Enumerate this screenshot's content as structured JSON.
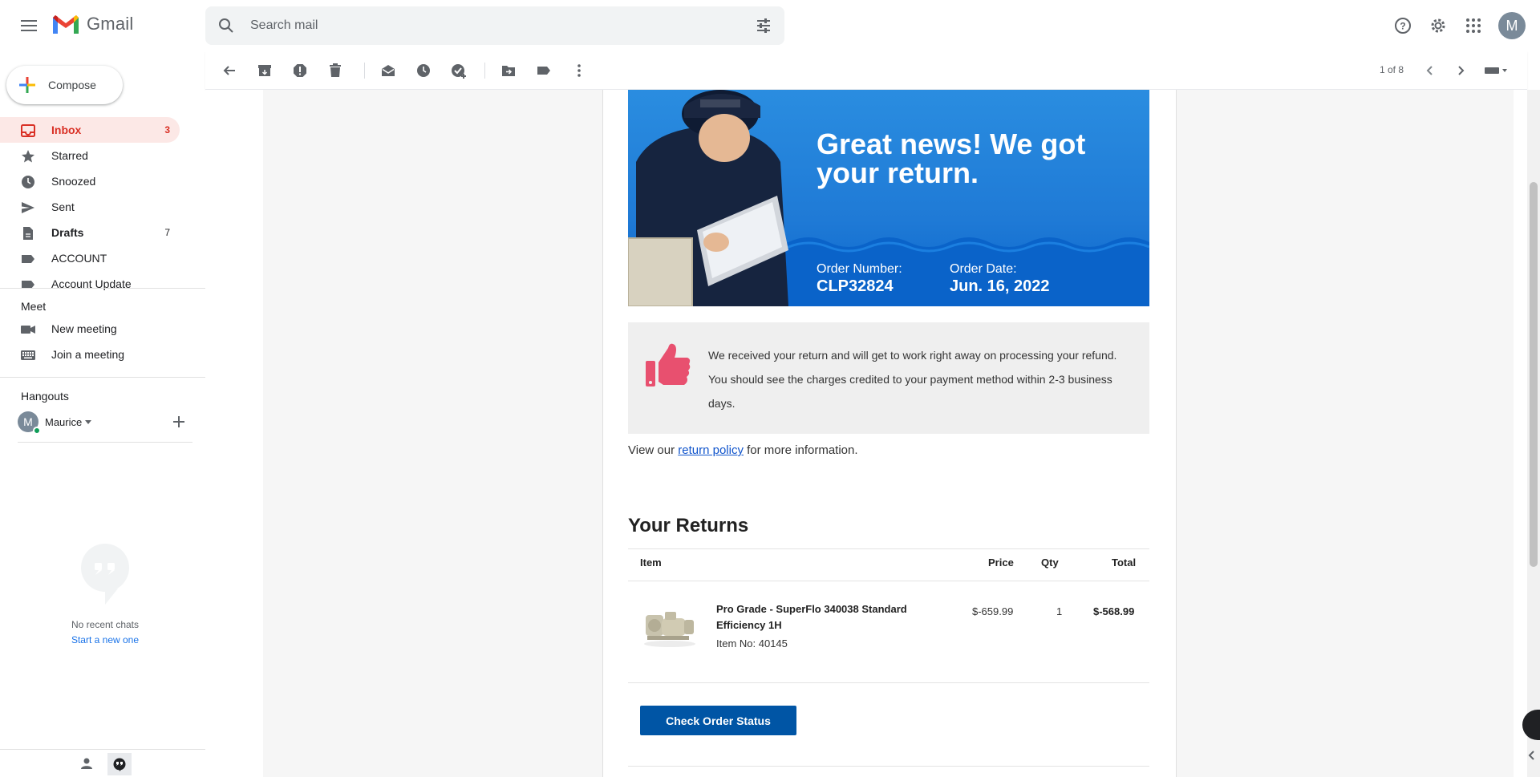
{
  "app": {
    "name": "Gmail",
    "brand_red": "#d93025"
  },
  "header": {
    "search_placeholder": "Search mail",
    "avatar_letter": "M"
  },
  "sidebar": {
    "compose_label": "Compose",
    "items": [
      {
        "label": "Inbox",
        "count": "3",
        "icon": "inbox-icon",
        "active": true
      },
      {
        "label": "Starred",
        "count": "",
        "icon": "star-icon"
      },
      {
        "label": "Snoozed",
        "count": "",
        "icon": "clock-icon"
      },
      {
        "label": "Sent",
        "count": "",
        "icon": "send-icon"
      },
      {
        "label": "Drafts",
        "count": "7",
        "icon": "draft-icon",
        "bold": true
      },
      {
        "label": "ACCOUNT",
        "count": "",
        "icon": "label-icon"
      },
      {
        "label": "Account Update",
        "count": "",
        "icon": "label-icon"
      }
    ],
    "meet": {
      "title": "Meet",
      "new_meeting": "New meeting",
      "join_meeting": "Join a meeting"
    },
    "hangouts": {
      "title": "Hangouts",
      "user_name": "Maurice",
      "user_initial": "M",
      "no_chats": "No recent chats",
      "start_new": "Start a new one"
    }
  },
  "toolbar": {
    "pager": "1 of 8"
  },
  "email": {
    "hero_title": "Great news! We got your return.",
    "order_number_label": "Order Number:",
    "order_number": "CLP32824",
    "order_date_label": "Order Date:",
    "order_date": "Jun. 16, 2022",
    "notice_text": "We received your return and will get to work right away on processing your refund. You should see the charges credited to your payment method within 2-3 business days.",
    "policy_prefix": "View our ",
    "policy_link": "return policy",
    "policy_suffix": " for more information.",
    "returns_title": "Your Returns",
    "table_headers": {
      "item": "Item",
      "price": "Price",
      "qty": "Qty",
      "total": "Total"
    },
    "item": {
      "name": "Pro Grade - SuperFlo 340038 Standard Efficiency 1H",
      "item_no": "Item No: 40145",
      "price": "$-659.99",
      "qty": "1",
      "total": "$-568.99"
    },
    "status_button": "Check Order Status"
  }
}
